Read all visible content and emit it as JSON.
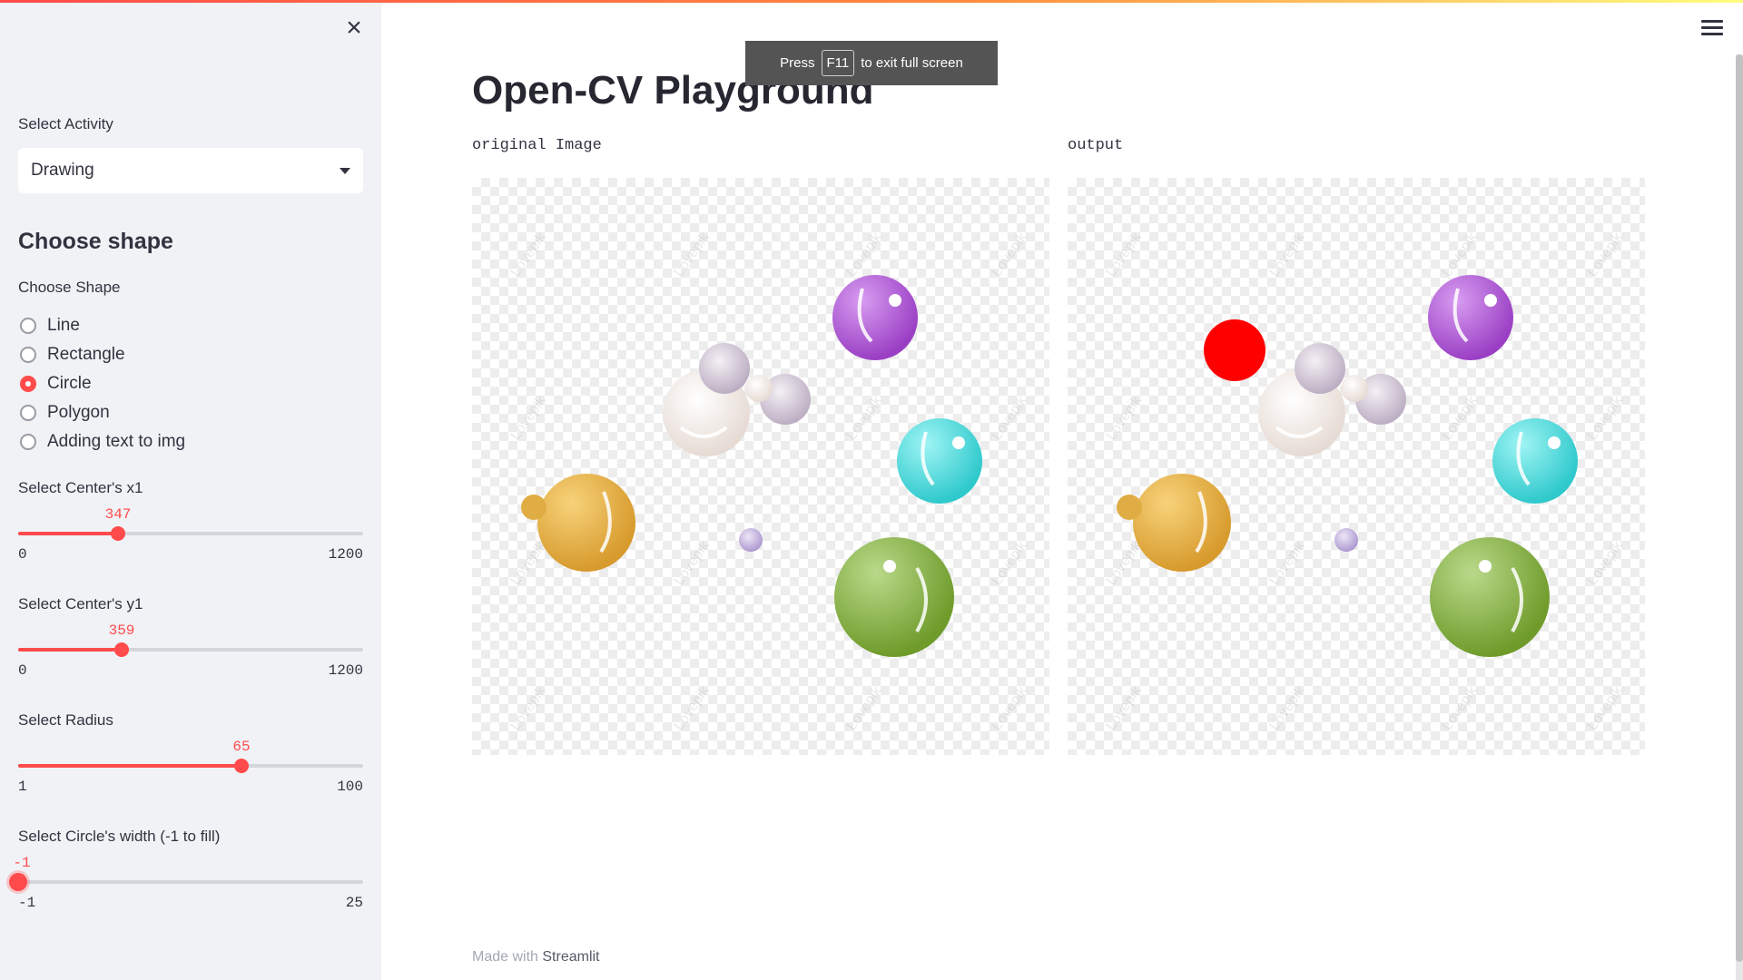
{
  "sidebar": {
    "close_icon": "close-icon",
    "activity_label": "Select Activity",
    "activity_value": "Drawing",
    "section_title": "Choose shape",
    "shape_label": "Choose Shape",
    "shapes": [
      {
        "label": "Line",
        "checked": false
      },
      {
        "label": "Rectangle",
        "checked": false
      },
      {
        "label": "Circle",
        "checked": true
      },
      {
        "label": "Polygon",
        "checked": false
      },
      {
        "label": "Adding text to img",
        "checked": false
      }
    ],
    "sliders": {
      "x1": {
        "label": "Select Center's x1",
        "value": "347",
        "min": "0",
        "max": "1200"
      },
      "y1": {
        "label": "Select Center's y1",
        "value": "359",
        "min": "0",
        "max": "1200"
      },
      "radius": {
        "label": "Select Radius",
        "value": "65",
        "min": "1",
        "max": "100"
      },
      "width": {
        "label": "Select Circle's width (-1 to fill)",
        "value": "-1",
        "min": "-1",
        "max": "25"
      }
    }
  },
  "header": {
    "menu_icon": "hamburger-menu-icon",
    "fullscreen_toast": {
      "prefix": "Press",
      "key": "F11",
      "suffix": "to exit full screen"
    }
  },
  "main": {
    "title": "Open-CV Playground",
    "original_caption": "original Image",
    "output_caption": "output",
    "watermark": "Lovepik"
  },
  "footer": {
    "prefix": "Made with",
    "brand": "Streamlit"
  },
  "colors": {
    "accent": "#ff4b4b",
    "sidebar_bg": "#f0f2f6",
    "drawn_circle": "#ff0000"
  }
}
